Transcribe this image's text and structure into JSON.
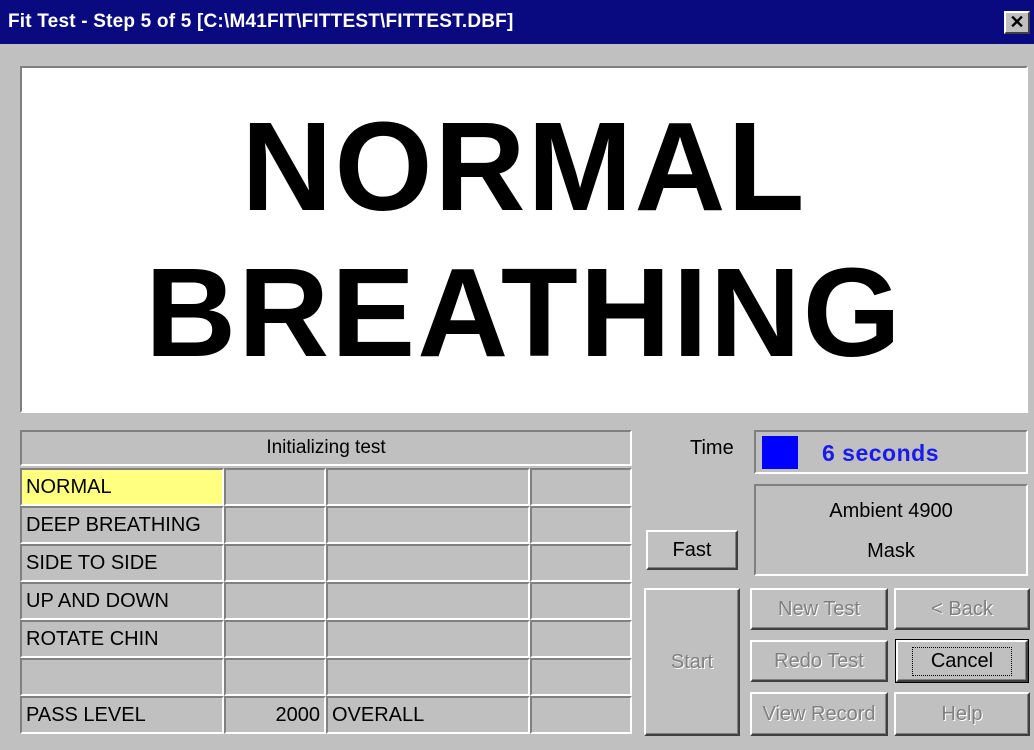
{
  "window": {
    "title": "Fit Test - Step 5 of 5 [C:\\M41FIT\\FITTEST\\FITTEST.DBF]",
    "close_glyph": "✕"
  },
  "display": {
    "line1": "NORMAL",
    "line2": "BREATHING"
  },
  "grid": {
    "header": "Initializing test",
    "rows": [
      {
        "exercise": "NORMAL",
        "c1": "",
        "c2": "",
        "c3": ""
      },
      {
        "exercise": "DEEP BREATHING",
        "c1": "",
        "c2": "",
        "c3": ""
      },
      {
        "exercise": "SIDE TO SIDE",
        "c1": "",
        "c2": "",
        "c3": ""
      },
      {
        "exercise": "UP AND DOWN",
        "c1": "",
        "c2": "",
        "c3": ""
      },
      {
        "exercise": "ROTATE CHIN",
        "c1": "",
        "c2": "",
        "c3": ""
      },
      {
        "exercise": "",
        "c1": "",
        "c2": "",
        "c3": ""
      }
    ],
    "footer": {
      "label": "PASS LEVEL",
      "value": "2000",
      "overall": "OVERALL",
      "extra": ""
    }
  },
  "time": {
    "label": "Time",
    "value": "6 seconds"
  },
  "ambient": {
    "line1": "Ambient 4900",
    "line2": "Mask"
  },
  "buttons": {
    "fast": "Fast",
    "start": "Start",
    "new_test": "New Test",
    "back": "< Back",
    "redo_test": "Redo Test",
    "cancel": "Cancel",
    "view_record": "View Record",
    "help": "Help"
  },
  "colors": {
    "titlebar": "#0a0a80",
    "highlight": "#ffff80",
    "time_indicator": "#0000ff",
    "time_text": "#1a1aee"
  }
}
